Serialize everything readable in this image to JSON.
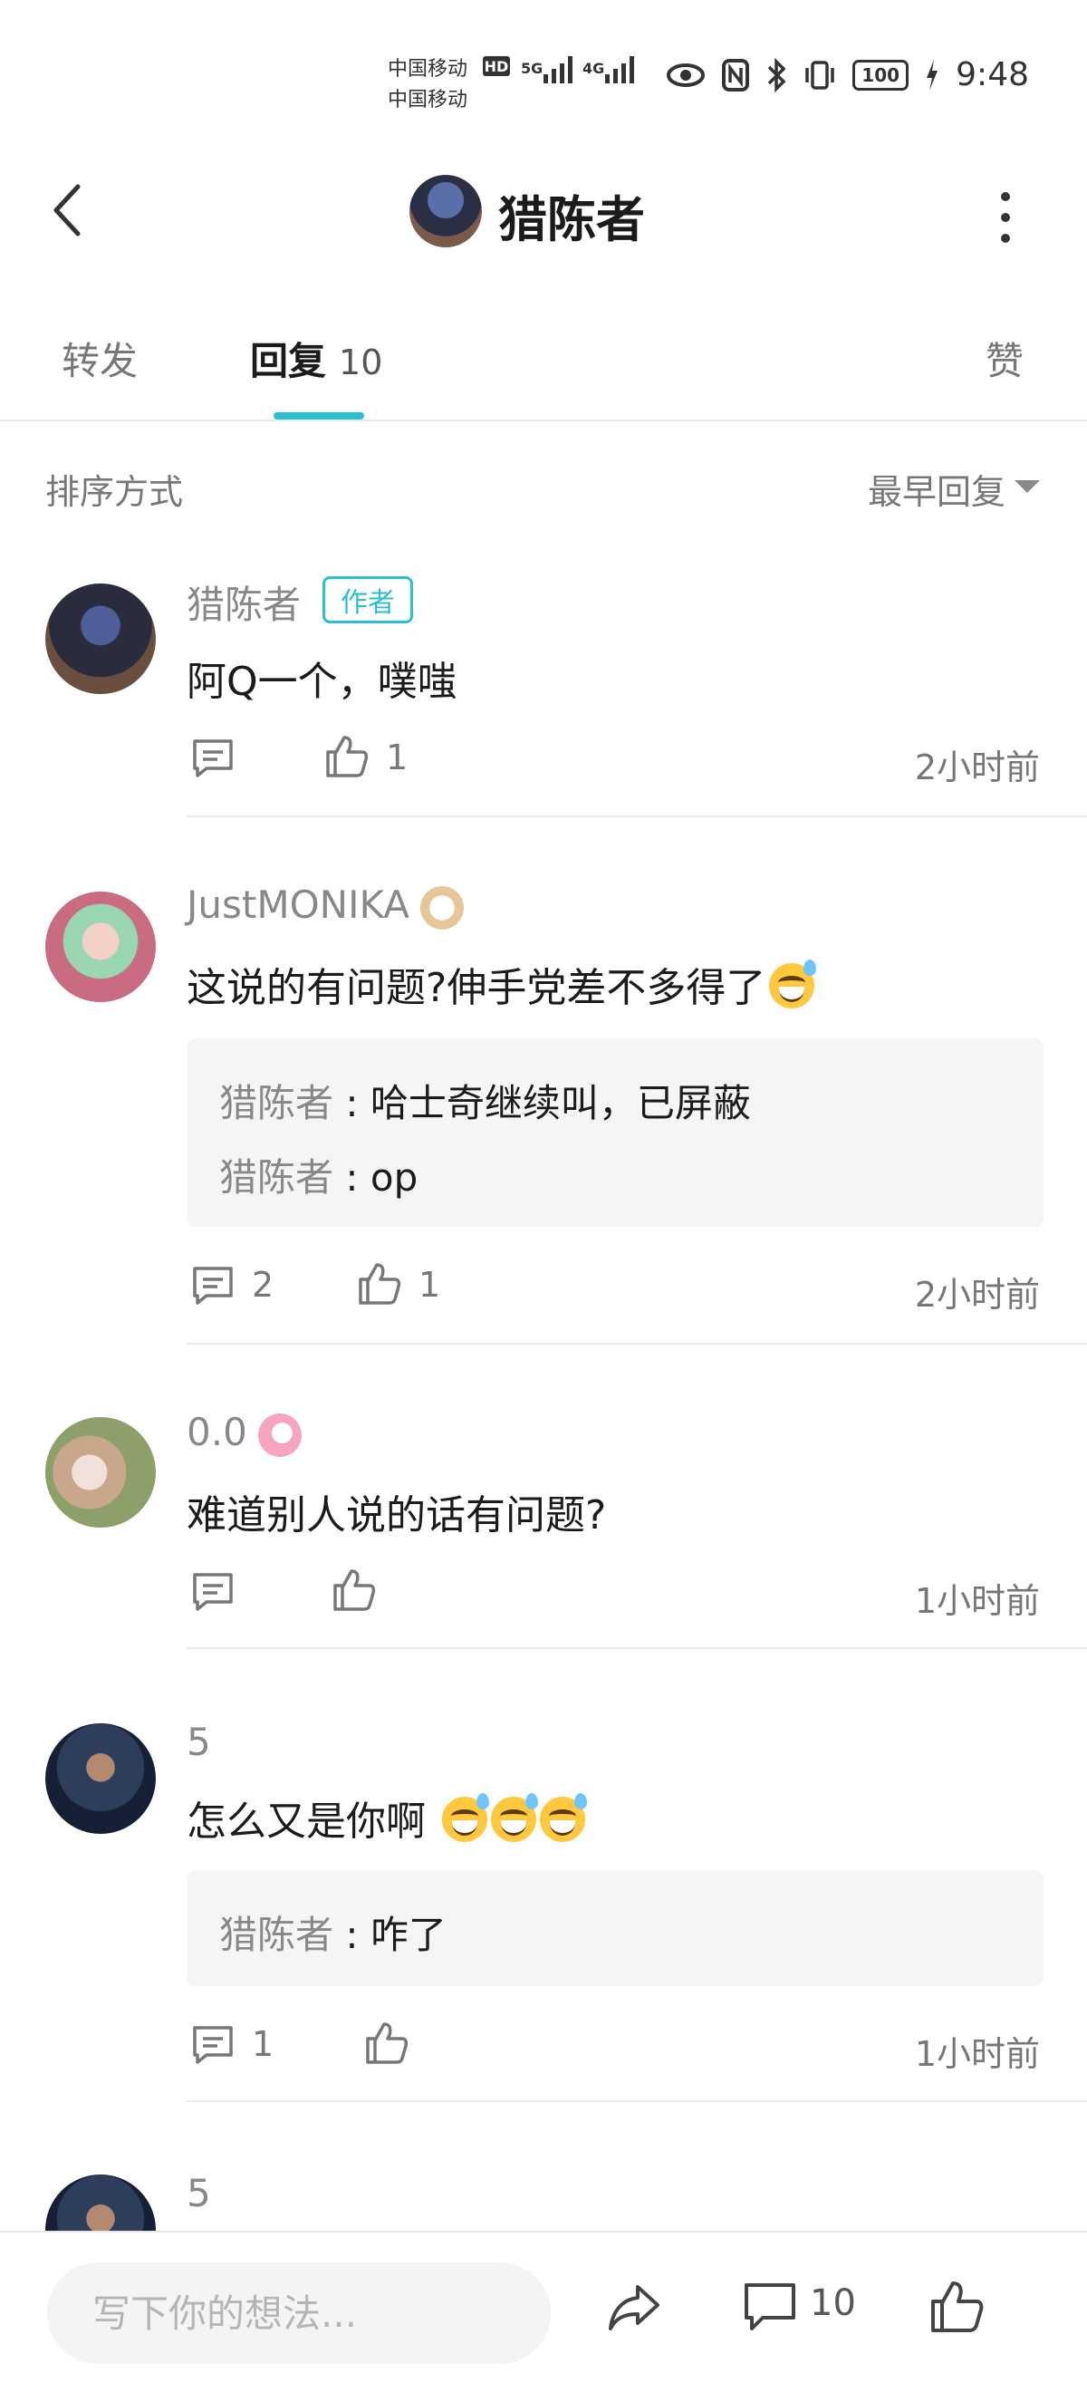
{
  "status_bar": {
    "carrier1": "中国移动",
    "carrier2": "中国移动",
    "hd": "HD",
    "net1": "5G",
    "net2": "4G",
    "battery": "100",
    "time": "9:48"
  },
  "header": {
    "title": "猎陈者"
  },
  "tabs": [
    {
      "label": "转发"
    },
    {
      "label": "回复",
      "count": "10"
    },
    {
      "label": "赞"
    }
  ],
  "sort": {
    "label": "排序方式",
    "value": "最早回复"
  },
  "comments": [
    {
      "name": "猎陈者",
      "badge": "作者",
      "text": "阿Q一个，噗嗤",
      "like_count": "1",
      "time": "2小时前"
    },
    {
      "name": "JustMONIKA",
      "text": "这说的有问题?伸手党差不多得了",
      "replies": [
        {
          "author": "猎陈者",
          "sep": " : ",
          "text": "哈士奇继续叫，已屏蔽"
        },
        {
          "author": "猎陈者",
          "sep": " : ",
          "text": "op"
        }
      ],
      "reply_count": "2",
      "like_count": "1",
      "time": "2小时前"
    },
    {
      "name": "0.0",
      "text": "难道别人说的话有问题?",
      "time": "1小时前"
    },
    {
      "name": "5",
      "text": "怎么又是你啊",
      "replies": [
        {
          "author": "猎陈者",
          "sep": " : ",
          "text": "咋了"
        }
      ],
      "reply_count": "1",
      "time": "1小时前"
    },
    {
      "name": "5"
    }
  ],
  "bottom_bar": {
    "input_placeholder": "写下你的想法...",
    "comment_count": "10"
  },
  "colors": {
    "accent": "#2bbfd1",
    "text_primary": "#1b1b1b",
    "text_secondary": "#888888"
  }
}
